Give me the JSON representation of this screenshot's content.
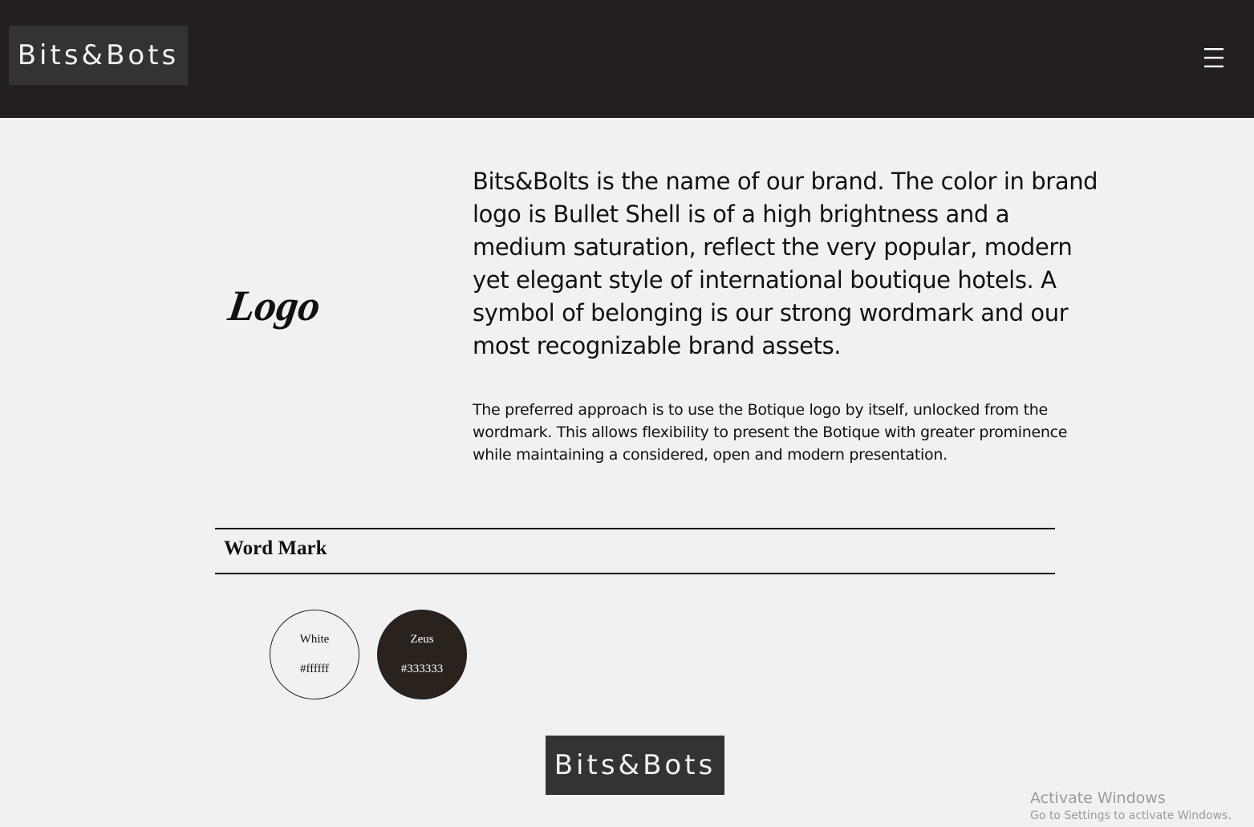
{
  "header": {
    "brand": "Bits&Bots",
    "menu_icon": "hamburger-menu-icon"
  },
  "logo_section": {
    "logo_word": "Logo",
    "intro": "Bits&Bolts is the name of our brand. The color in brand logo is Bullet Shell is of a high brightness and a medium saturation, reflect the very popular, modern yet elegant style of international boutique hotels. A symbol of belonging is our strong wordmark and our most recognizable brand assets.",
    "secondary": "The preferred approach is to use the Botique logo by itself, unlocked from the wordmark. This allows flexibility to present the Botique with greater prominence while maintaining a considered, open and modern presentation."
  },
  "word_mark": {
    "title": "Word Mark",
    "swatches": [
      {
        "name": "White",
        "hex": "#ffffff"
      },
      {
        "name": "Zeus",
        "hex": "#333333"
      }
    ]
  },
  "footer": {
    "brand": "Bits&Bots"
  },
  "watermark": {
    "title": "Activate Windows",
    "subtitle": "Go to Settings to activate Windows."
  },
  "colors": {
    "header_bg": "#231f20",
    "brand_box_bg": "#333333",
    "page_bg": "#f1f1f1"
  }
}
